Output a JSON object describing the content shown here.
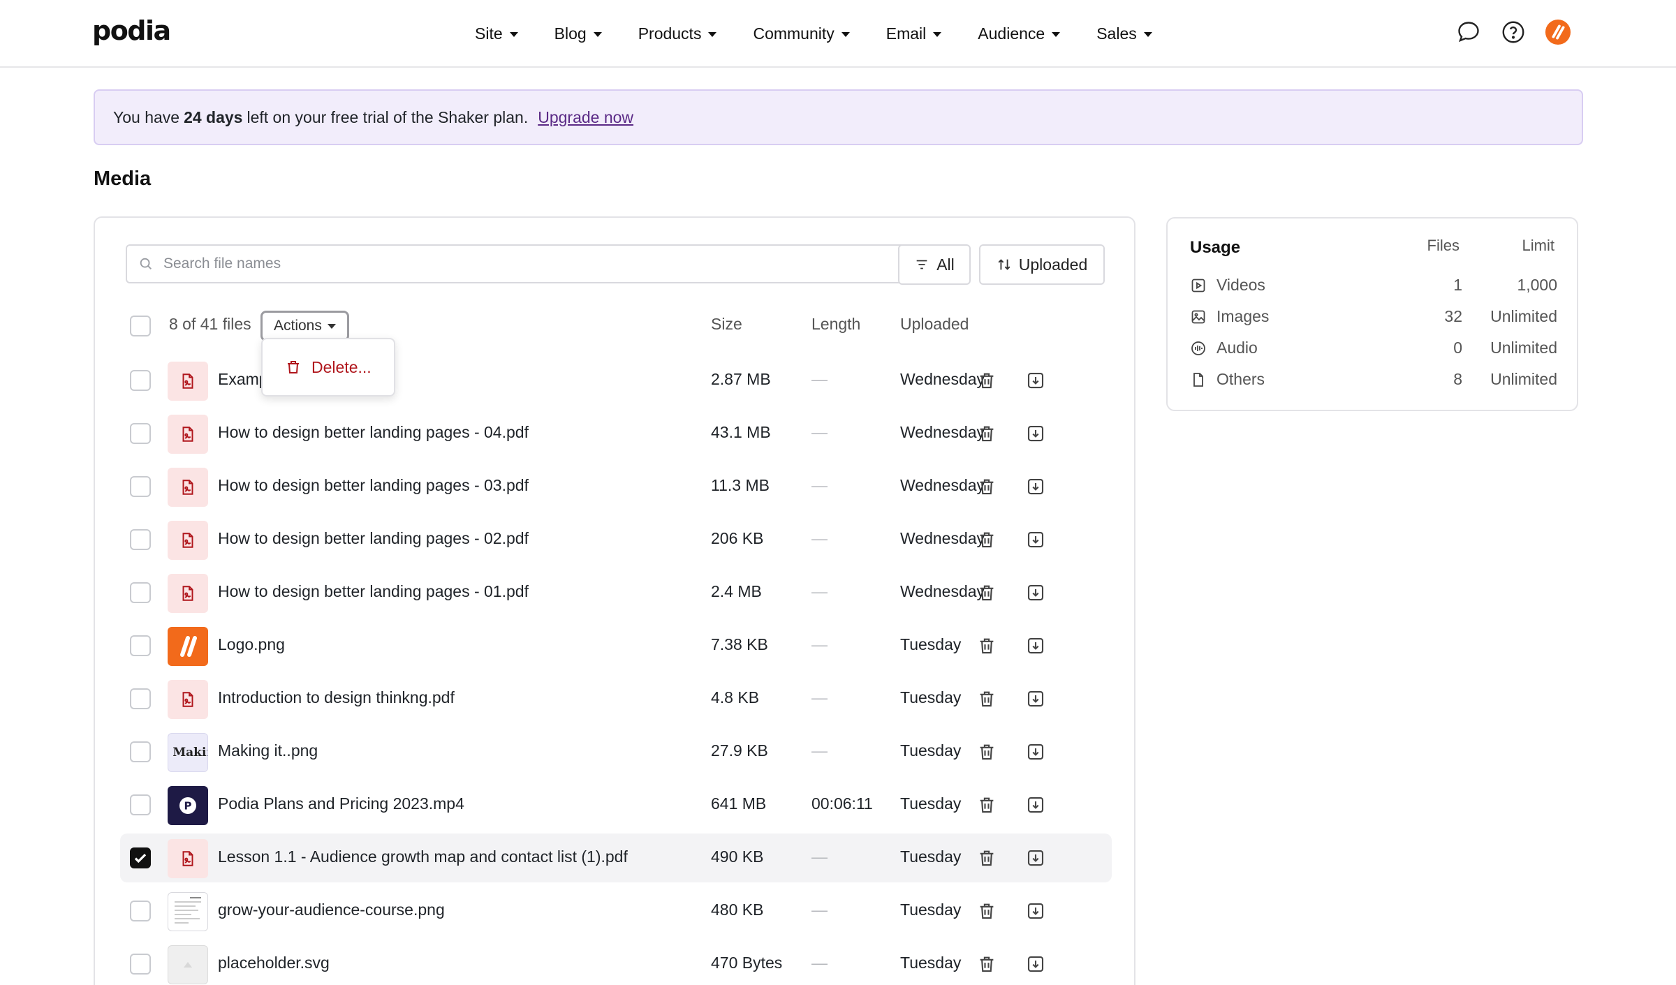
{
  "brand": {
    "logo": "podia",
    "accent": "#f26a1b"
  },
  "nav": {
    "items": [
      {
        "label": "Site"
      },
      {
        "label": "Blog"
      },
      {
        "label": "Products"
      },
      {
        "label": "Community"
      },
      {
        "label": "Email"
      },
      {
        "label": "Audience"
      },
      {
        "label": "Sales"
      }
    ],
    "icons": [
      "chat-icon",
      "help-icon",
      "avatar"
    ]
  },
  "banner": {
    "prefix": "You have",
    "days": "24 days",
    "suffix": "left on your free trial of the Shaker plan.",
    "link": "Upgrade now"
  },
  "page": {
    "title": "Media"
  },
  "toolbar": {
    "search_placeholder": "Search file names",
    "filter_label": "All",
    "sort_label": "Uploaded"
  },
  "list": {
    "selection_count": "8 of 41 files",
    "actions_label": "Actions",
    "columns": {
      "size": "Size",
      "length": "Length",
      "uploaded": "Uploaded"
    },
    "dropdown": {
      "delete_label": "Delete..."
    },
    "rows": [
      {
        "name": "Examp",
        "size": "2.87 MB",
        "length": "—",
        "uploaded": "Wednesday",
        "thumb": "pdf",
        "checked": false
      },
      {
        "name": "How to design better landing pages - 04.pdf",
        "size": "43.1 MB",
        "length": "—",
        "uploaded": "Wednesday",
        "thumb": "pdf",
        "checked": false
      },
      {
        "name": "How to design better landing pages - 03.pdf",
        "size": "11.3 MB",
        "length": "—",
        "uploaded": "Wednesday",
        "thumb": "pdf",
        "checked": false
      },
      {
        "name": "How to design better landing pages - 02.pdf",
        "size": "206 KB",
        "length": "—",
        "uploaded": "Wednesday",
        "thumb": "pdf",
        "checked": false
      },
      {
        "name": "How to design better landing pages - 01.pdf",
        "size": "2.4 MB",
        "length": "—",
        "uploaded": "Wednesday",
        "thumb": "pdf",
        "checked": false
      },
      {
        "name": "Logo.png",
        "size": "7.38 KB",
        "length": "—",
        "uploaded": "Tuesday",
        "thumb": "orange",
        "checked": false
      },
      {
        "name": "Introduction to design thinkng.pdf",
        "size": "4.8 KB",
        "length": "—",
        "uploaded": "Tuesday",
        "thumb": "pdf",
        "checked": false
      },
      {
        "name": "Making it..png",
        "size": "27.9 KB",
        "length": "—",
        "uploaded": "Tuesday",
        "thumb": "light",
        "thumb_text": "' Makin",
        "checked": false
      },
      {
        "name": "Podia Plans and Pricing 2023.mp4",
        "size": "641 MB",
        "length": "00:06:11",
        "uploaded": "Tuesday",
        "thumb": "navy",
        "checked": false
      },
      {
        "name": "Lesson 1.1 - Audience growth map and contact list (1).pdf",
        "size": "490 KB",
        "length": "—",
        "uploaded": "Tuesday",
        "thumb": "pdf",
        "checked": true
      },
      {
        "name": "grow-your-audience-course.png",
        "size": "480 KB",
        "length": "—",
        "uploaded": "Tuesday",
        "thumb": "doc",
        "checked": false
      },
      {
        "name": "placeholder.svg",
        "size": "470 Bytes",
        "length": "—",
        "uploaded": "Tuesday",
        "thumb": "gray",
        "checked": false
      }
    ]
  },
  "usage": {
    "title": "Usage",
    "col_files": "Files",
    "col_limit": "Limit",
    "rows": [
      {
        "label": "Videos",
        "files": "1",
        "limit": "1,000",
        "icon": "video-icon"
      },
      {
        "label": "Images",
        "files": "32",
        "limit": "Unlimited",
        "icon": "image-icon"
      },
      {
        "label": "Audio",
        "files": "0",
        "limit": "Unlimited",
        "icon": "audio-icon"
      },
      {
        "label": "Others",
        "files": "8",
        "limit": "Unlimited",
        "icon": "file-icon"
      }
    ]
  }
}
